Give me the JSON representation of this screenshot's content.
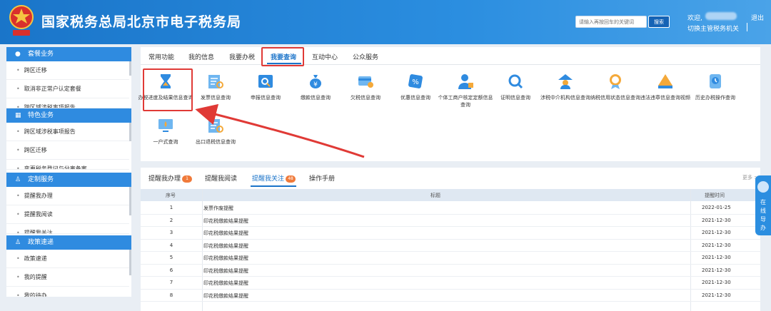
{
  "header": {
    "title": "国家税务总局北京市电子税务局",
    "search_placeholder": "请输入再按回车的关键词",
    "search_button": "搜索",
    "welcome": "欢迎,",
    "switch_agency": "切换主管税务机关",
    "logout": "退出",
    "brand_color": "#1a75c9"
  },
  "sidebar": {
    "sections": [
      {
        "title": "套餐业务",
        "icon": "package-icon",
        "items": [
          "跨区迁移",
          "取消非正常户认定套餐",
          "跨区域涉税事项报告"
        ]
      },
      {
        "title": "特色业务",
        "icon": "grid-icon",
        "items": [
          "跨区域涉税事项报告",
          "跨区迁移",
          "变更税务登记与分离备案"
        ]
      },
      {
        "title": "定制服务",
        "icon": "user-icon",
        "items": [
          "提醒我办理",
          "提醒我阅读",
          "提醒我关注"
        ]
      },
      {
        "title": "政策速递",
        "icon": "user-icon",
        "items": [
          "政策速递",
          "我的提醒",
          "我的待办"
        ]
      }
    ]
  },
  "tabs": [
    "常用功能",
    "我的信息",
    "我要办税",
    "我要查询",
    "互动中心",
    "公众服务"
  ],
  "active_tab": "我要查询",
  "services": [
    {
      "label": "办税进度及结果信息查询",
      "icon": "hourglass-icon"
    },
    {
      "label": "发票信息查询",
      "icon": "invoice-search-icon"
    },
    {
      "label": "申报信息查询",
      "icon": "declaration-search-icon"
    },
    {
      "label": "缴款信息查询",
      "icon": "money-bag-icon"
    },
    {
      "label": "欠税信息查询",
      "icon": "card-icon"
    },
    {
      "label": "优惠信息查询",
      "icon": "discount-icon"
    },
    {
      "label": "个体工商户核定定额信息查询",
      "icon": "person-icon"
    },
    {
      "label": "证明信息查询",
      "icon": "certificate-search-icon"
    },
    {
      "label": "涉税中介机构信息查询",
      "icon": "agency-icon"
    },
    {
      "label": "纳税信用状态信息查询",
      "icon": "medal-icon"
    },
    {
      "label": "违法违章信息查询视频",
      "icon": "warning-icon"
    },
    {
      "label": "历史办税操作查询",
      "icon": "history-icon"
    },
    {
      "label": "一户式查询",
      "icon": "monitor-icon"
    },
    {
      "label": "出口退税信息查询",
      "icon": "export-search-icon"
    }
  ],
  "bottom_tabs": [
    {
      "label": "提醒我办理",
      "badge": "1"
    },
    {
      "label": "提醒我阅读",
      "badge": ""
    },
    {
      "label": "提醒我关注",
      "badge": "48"
    },
    {
      "label": "操作手册",
      "badge": ""
    }
  ],
  "active_bottom_tab": "提醒我关注",
  "more_label": "更多 >",
  "table": {
    "headers": [
      "序号",
      "标题",
      "提醒时间"
    ],
    "rows": [
      [
        "1",
        "发票作废提醒",
        "2022-01-25"
      ],
      [
        "2",
        "印花税缴款结果提醒",
        "2021-12-30"
      ],
      [
        "3",
        "印花税缴款结果提醒",
        "2021-12-30"
      ],
      [
        "4",
        "印花税缴款结果提醒",
        "2021-12-30"
      ],
      [
        "5",
        "印花税缴款结果提醒",
        "2021-12-30"
      ],
      [
        "6",
        "印花税缴款结果提醒",
        "2021-12-30"
      ],
      [
        "7",
        "印花税缴款结果提醒",
        "2021-12-30"
      ],
      [
        "8",
        "印花税缴款结果提醒",
        "2021-12-30"
      ]
    ]
  },
  "float_help": "在线导办"
}
